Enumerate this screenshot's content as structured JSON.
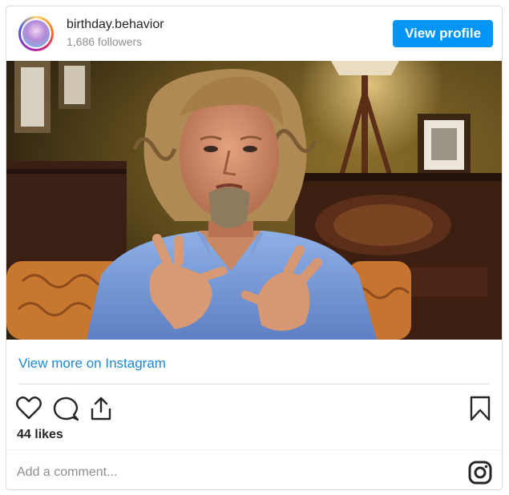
{
  "header": {
    "username": "birthday.behavior",
    "followers": "1,686 followers",
    "view_profile_label": "View profile"
  },
  "post": {
    "view_more_label": "View more on Instagram",
    "likes": "44 likes",
    "comment_placeholder": "Add a comment..."
  },
  "colors": {
    "accent": "#0095f6",
    "link": "#1a87d8",
    "text": "#262626",
    "muted": "#8e8e8e",
    "border": "#dbdbdb"
  },
  "icons": {
    "like": "heart-icon",
    "comment": "comment-bubble-icon",
    "share": "share-icon",
    "save": "bookmark-icon",
    "brand": "instagram-icon"
  }
}
